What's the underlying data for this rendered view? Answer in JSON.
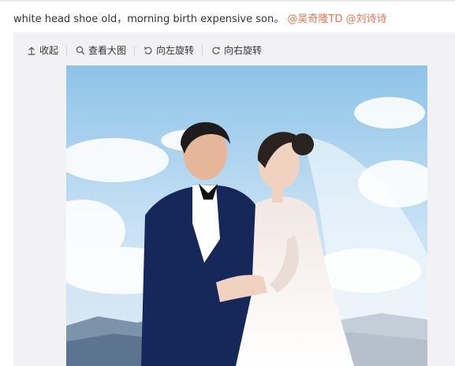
{
  "post": {
    "text": "white head shoe old，morning birth expensive son。",
    "mentions": [
      "@吴奇隆TD",
      "@刘诗诗"
    ]
  },
  "toolbar": {
    "collapse_label": "收起",
    "view_large_label": "查看大图",
    "rotate_left_label": "向左旋转",
    "rotate_right_label": "向右旋转"
  },
  "colors": {
    "mention": "#eb7350",
    "card_bg": "#f2f2f5"
  },
  "icons": [
    "collapse-icon",
    "magnifier-icon",
    "rotate-left-icon",
    "rotate-right-icon"
  ]
}
